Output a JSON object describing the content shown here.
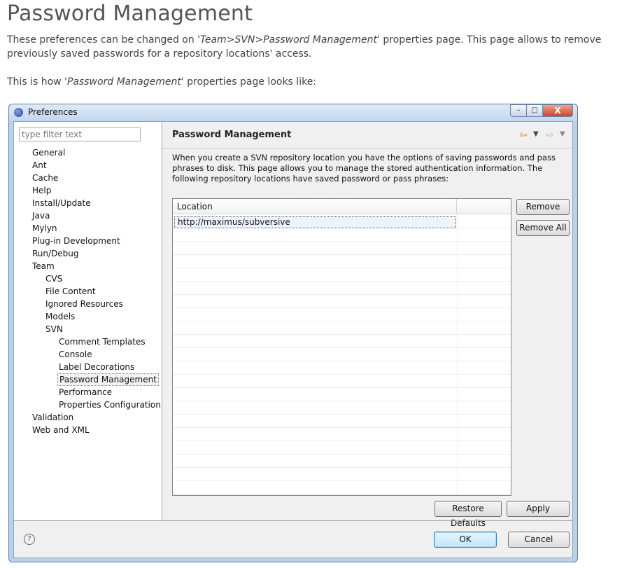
{
  "doc": {
    "title": "Password Management",
    "p1": {
      "a": "These preferences can be changed on ",
      "em": "'Team>SVN>Password Management'",
      "b": " properties page. This page allows to remove previously saved passwords for a repository locations' access."
    },
    "p2": {
      "a": "This is how ",
      "em": "'Password Management'",
      "b": " properties page looks like:"
    }
  },
  "window": {
    "title": "Preferences",
    "controls": {
      "minimize": "–",
      "maximize": "□",
      "close": "X"
    }
  },
  "filter": {
    "placeholder": "type filter text"
  },
  "tree": [
    {
      "label": "General",
      "level": 0
    },
    {
      "label": "Ant",
      "level": 0
    },
    {
      "label": "Cache",
      "level": 0
    },
    {
      "label": "Help",
      "level": 0
    },
    {
      "label": "Install/Update",
      "level": 0
    },
    {
      "label": "Java",
      "level": 0
    },
    {
      "label": "Mylyn",
      "level": 0
    },
    {
      "label": "Plug-in Development",
      "level": 0
    },
    {
      "label": "Run/Debug",
      "level": 0
    },
    {
      "label": "Team",
      "level": 0
    },
    {
      "label": "CVS",
      "level": 1
    },
    {
      "label": "File Content",
      "level": 1
    },
    {
      "label": "Ignored Resources",
      "level": 1
    },
    {
      "label": "Models",
      "level": 1
    },
    {
      "label": "SVN",
      "level": 1
    },
    {
      "label": "Comment Templates",
      "level": 2
    },
    {
      "label": "Console",
      "level": 2
    },
    {
      "label": "Label Decorations",
      "level": 2
    },
    {
      "label": "Password Management",
      "level": 2,
      "selected": true
    },
    {
      "label": "Performance",
      "level": 2
    },
    {
      "label": "Properties Configuration",
      "level": 2
    },
    {
      "label": "Validation",
      "level": 0
    },
    {
      "label": "Web and XML",
      "level": 0
    }
  ],
  "page": {
    "title": "Password Management",
    "description": "When you create a SVN repository location you have the options of saving passwords and pass phrases to disk. This page allows you to manage the stored authentication information. The following repository locations have saved password or pass phrases:",
    "table": {
      "columns": [
        "Location",
        ""
      ],
      "rows": [
        "http://maximus/subversive"
      ]
    },
    "buttons": {
      "remove": "Remove",
      "remove_all": "Remove All",
      "restore_defaults": "Restore Defaults",
      "apply": "Apply"
    }
  },
  "footer": {
    "help": "?",
    "ok": "OK",
    "cancel": "Cancel"
  }
}
